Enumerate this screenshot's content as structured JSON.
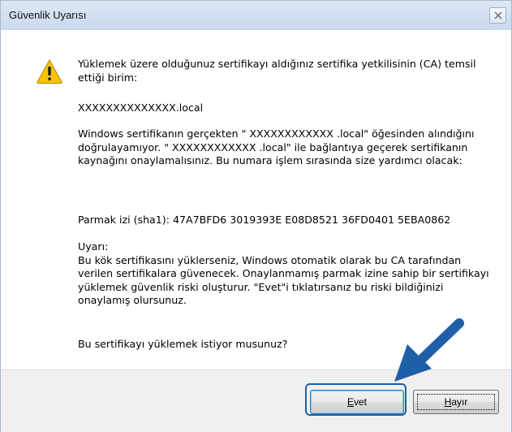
{
  "dialog": {
    "title": "Güvenlik Uyarısı",
    "intro": "Yüklemek üzere olduğunuz sertifikayı aldığınız sertifika yetkilisinin (CA) temsil ettiği birim:",
    "domain": "XXXXXXXXXXXXXX.local",
    "paragraph": "Windows sertifikanın gerçekten \" XXXXXXXXXXXX .local\" öğesinden alındığını doğrulayamıyor. \" XXXXXXXXXXXX .local\" ile bağlantıya geçerek sertifikanın kaynağını onaylamalısınız. Bu numara işlem sırasında size yardımcı olacak:",
    "fingerprint": "Parmak izi (sha1): 47A7BFD6 3019393E E08D8521 36FD0401 5EBA0862",
    "warning_heading": "Uyarı:",
    "warning_body": "Bu kök sertifikasını yüklerseniz, Windows otomatik olarak bu CA tarafından verilen sertifikalara güvenecek. Onaylanmamış parmak izine sahip bir sertifikayı yüklemek güvenlik riski oluşturur. \"Evet\"i tıklatırsanız bu riski bildiğinizi onaylamış olursunuz.",
    "question": "Bu sertifikayı yüklemek istiyor musunuz?"
  },
  "buttons": {
    "yes_first": "E",
    "yes_rest": "vet",
    "no_first": "H",
    "no_rest": "ayır"
  },
  "icons": {
    "close": "close-icon",
    "warning": "warning-icon",
    "arrow": "pointer-arrow-icon"
  },
  "colors": {
    "highlight": "#1f5fa8",
    "arrow": "#1f5fa8",
    "warning_fill": "#f5c400"
  }
}
